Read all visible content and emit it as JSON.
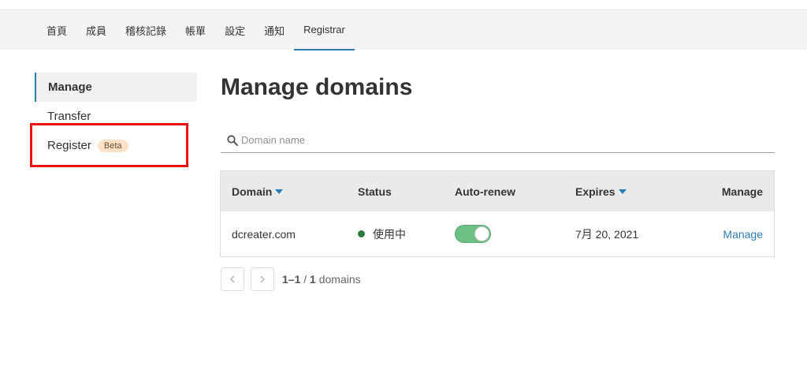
{
  "nav": {
    "tabs": [
      {
        "label": "首頁"
      },
      {
        "label": "成員"
      },
      {
        "label": "稽核記錄"
      },
      {
        "label": "帳單"
      },
      {
        "label": "設定"
      },
      {
        "label": "通知"
      },
      {
        "label": "Registrar"
      }
    ],
    "active_tab": "Registrar"
  },
  "sidebar": {
    "items": [
      {
        "label": "Manage"
      },
      {
        "label": "Transfer"
      },
      {
        "label": "Register",
        "badge": "Beta"
      }
    ],
    "active_item": "Manage"
  },
  "main": {
    "title": "Manage domains",
    "search": {
      "placeholder": "Domain name",
      "value": ""
    },
    "table": {
      "headers": {
        "domain": "Domain",
        "status": "Status",
        "auto_renew": "Auto-renew",
        "expires": "Expires",
        "manage": "Manage"
      },
      "rows": [
        {
          "domain": "dcreater.com",
          "status": "使用中",
          "auto_renew": true,
          "expires": "7月 20, 2021",
          "manage": "Manage"
        }
      ]
    },
    "pagination": {
      "range": "1–1",
      "separator": " / ",
      "total": "1",
      "unit": " domains"
    }
  },
  "colors": {
    "accent": "#2c7cb0",
    "status_active": "#2f7a3d",
    "toggle_on": "#6dbf86",
    "highlight": "#ee1111",
    "beta_badge": "#fde2c9"
  }
}
